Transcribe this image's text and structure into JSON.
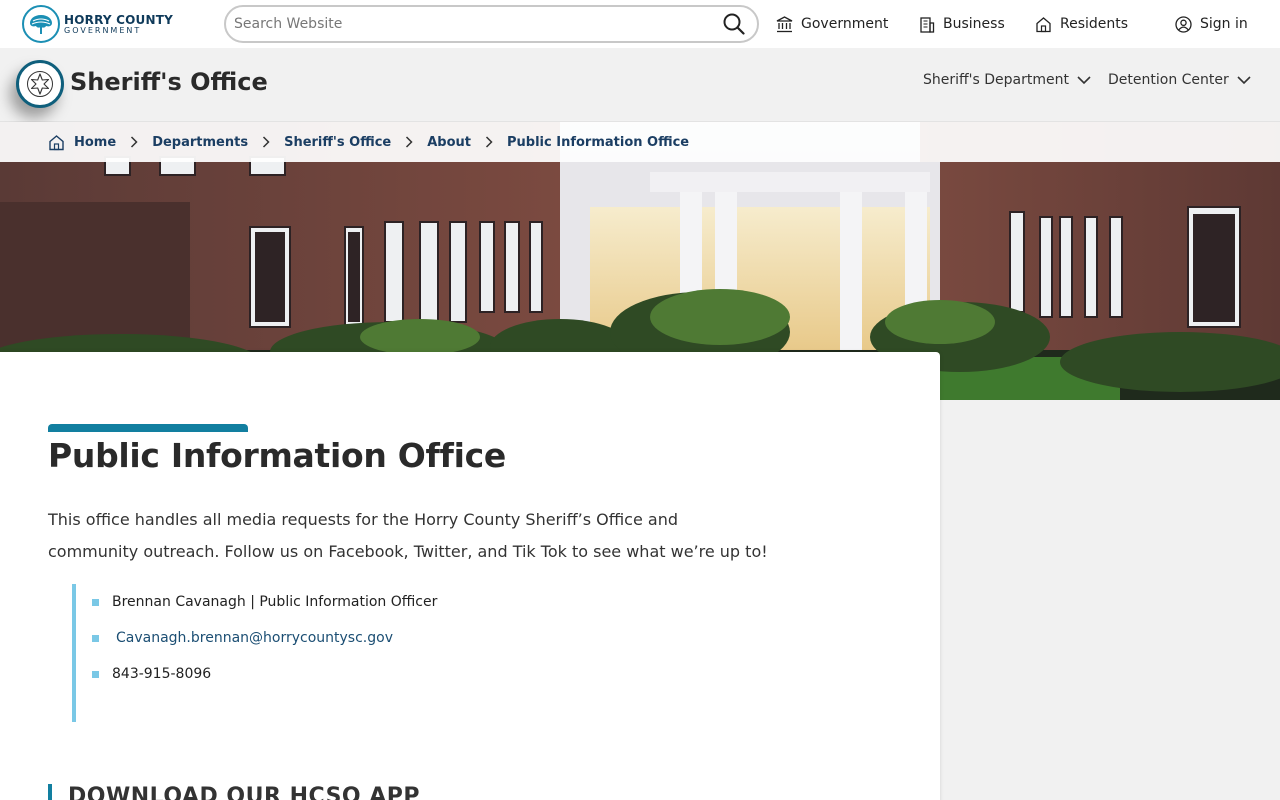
{
  "header": {
    "logo": {
      "line1": "HORRY COUNTY",
      "line2": "GOVERNMENT"
    },
    "search": {
      "placeholder": "Search Website"
    },
    "nav": [
      {
        "label": "Government",
        "icon": "government-building-icon"
      },
      {
        "label": "Business",
        "icon": "office-building-icon"
      },
      {
        "label": "Residents",
        "icon": "home-icon"
      },
      {
        "label": "Sign in",
        "icon": "user-circle-icon"
      }
    ]
  },
  "department": {
    "title": "Sheriff's Office",
    "badge_icon": "sheriff-star-icon",
    "menus": [
      {
        "label": "Sheriff's Department"
      },
      {
        "label": "Detention Center"
      }
    ]
  },
  "breadcrumb": [
    "Home",
    "Departments",
    "Sheriff's Office",
    "About",
    "Public Information Office"
  ],
  "main": {
    "title": "Public Information Office",
    "intro": "This office handles all media requests for the Horry County Sheriff’s Office and community outreach. Follow us on Facebook, Twitter, and Tik Tok to see what we’re up to!",
    "contacts": [
      {
        "text": "Brennan Cavanagh | Public Information Officer"
      },
      {
        "text": "Cavanagh.brennan@horrycountysc.gov"
      },
      {
        "text": "843-915-8096"
      }
    ],
    "section_heading": "DOWNLOAD OUR HCSO APP"
  },
  "colors": {
    "accent": "#127fa0",
    "accent_light": "#7ac8e6",
    "link": "#1b4e73",
    "breadcrumb_text": "#1b3e63"
  }
}
